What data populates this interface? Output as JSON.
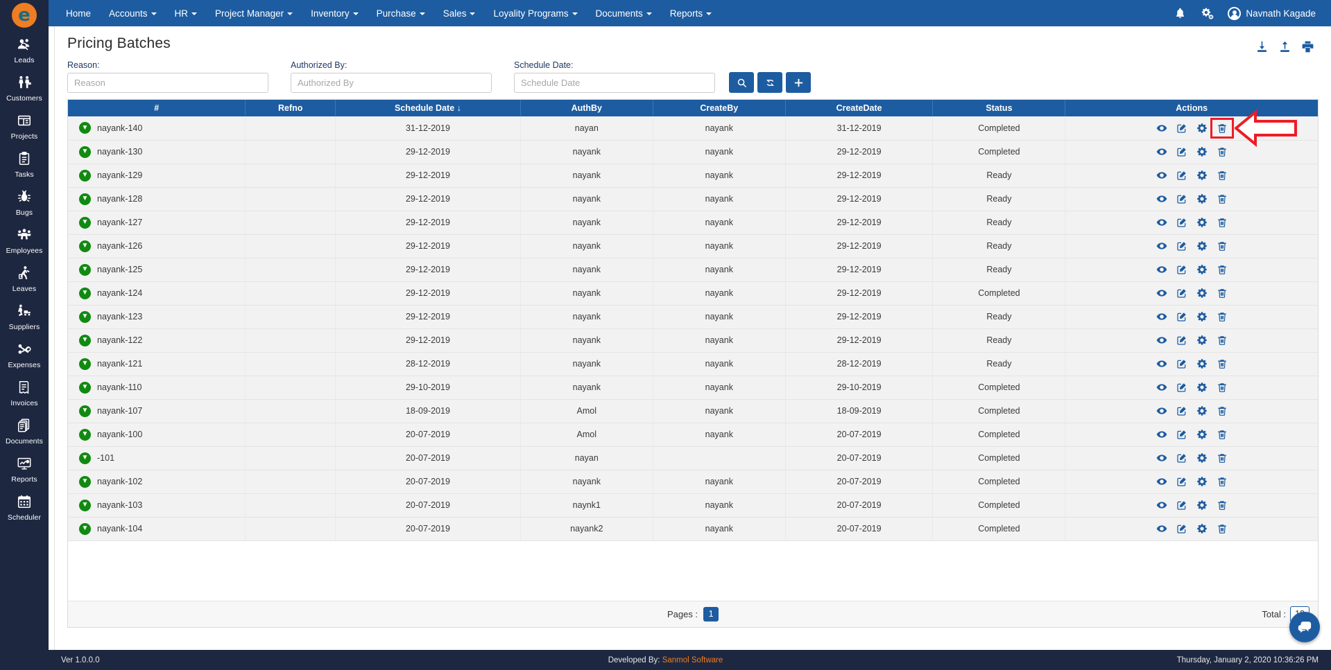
{
  "brand": {
    "logo_text": "e",
    "accent": "#ef7d22",
    "primary": "#1d5ca0",
    "sidebar_bg": "#1e2740"
  },
  "sidebar": {
    "items": [
      {
        "icon": "leads-icon",
        "label": "Leads"
      },
      {
        "icon": "customers-icon",
        "label": "Customers"
      },
      {
        "icon": "projects-icon",
        "label": "Projects"
      },
      {
        "icon": "tasks-icon",
        "label": "Tasks"
      },
      {
        "icon": "bugs-icon",
        "label": "Bugs"
      },
      {
        "icon": "employees-icon",
        "label": "Employees"
      },
      {
        "icon": "leaves-icon",
        "label": "Leaves"
      },
      {
        "icon": "suppliers-icon",
        "label": "Suppliers"
      },
      {
        "icon": "expenses-icon",
        "label": "Expenses"
      },
      {
        "icon": "invoices-icon",
        "label": "Invoices"
      },
      {
        "icon": "documents-icon",
        "label": "Documents"
      },
      {
        "icon": "reports-icon",
        "label": "Reports"
      },
      {
        "icon": "scheduler-icon",
        "label": "Scheduler"
      }
    ]
  },
  "topnav": {
    "items": [
      {
        "label": "Home",
        "dropdown": false
      },
      {
        "label": "Accounts",
        "dropdown": true
      },
      {
        "label": "HR",
        "dropdown": true
      },
      {
        "label": "Project Manager",
        "dropdown": true
      },
      {
        "label": "Inventory",
        "dropdown": true
      },
      {
        "label": "Purchase",
        "dropdown": true
      },
      {
        "label": "Sales",
        "dropdown": true
      },
      {
        "label": "Loyality Programs",
        "dropdown": true
      },
      {
        "label": "Documents",
        "dropdown": true
      },
      {
        "label": "Reports",
        "dropdown": true
      }
    ],
    "notification_icon": "bell-icon",
    "settings_icon": "gears-icon",
    "user_name": "Navnath Kagade"
  },
  "page": {
    "title": "Pricing Batches",
    "io_actions": [
      {
        "icon": "download-icon",
        "name": "download-button"
      },
      {
        "icon": "upload-icon",
        "name": "upload-button"
      },
      {
        "icon": "print-icon",
        "name": "print-button"
      }
    ]
  },
  "filters": {
    "reason": {
      "label": "Reason:",
      "placeholder": "Reason",
      "value": ""
    },
    "authorized_by": {
      "label": "Authorized By:",
      "placeholder": "Authorized By",
      "value": ""
    },
    "schedule_date": {
      "label": "Schedule Date:",
      "placeholder": "Schedule Date",
      "value": ""
    },
    "buttons": [
      {
        "icon": "search-icon",
        "name": "search-button"
      },
      {
        "icon": "refresh-icon",
        "name": "refresh-button"
      },
      {
        "icon": "plus-icon",
        "name": "add-button"
      }
    ]
  },
  "table": {
    "columns": [
      "#",
      "Refno",
      "Schedule Date ↓",
      "AuthBy",
      "CreateBy",
      "CreateDate",
      "Status",
      "Actions"
    ],
    "sort_column": "Schedule Date",
    "sort_direction": "desc",
    "row_actions": [
      "view-icon",
      "edit-icon",
      "gear-icon",
      "delete-icon"
    ],
    "rows": [
      {
        "id": "nayank-140",
        "refno": "",
        "schedule_date": "31-12-2019",
        "authby": "nayan",
        "createby": "nayank",
        "createdate": "31-12-2019",
        "status": "Completed"
      },
      {
        "id": "nayank-130",
        "refno": "",
        "schedule_date": "29-12-2019",
        "authby": "nayank",
        "createby": "nayank",
        "createdate": "29-12-2019",
        "status": "Completed"
      },
      {
        "id": "nayank-129",
        "refno": "",
        "schedule_date": "29-12-2019",
        "authby": "nayank",
        "createby": "nayank",
        "createdate": "29-12-2019",
        "status": "Ready"
      },
      {
        "id": "nayank-128",
        "refno": "",
        "schedule_date": "29-12-2019",
        "authby": "nayank",
        "createby": "nayank",
        "createdate": "29-12-2019",
        "status": "Ready"
      },
      {
        "id": "nayank-127",
        "refno": "",
        "schedule_date": "29-12-2019",
        "authby": "nayank",
        "createby": "nayank",
        "createdate": "29-12-2019",
        "status": "Ready"
      },
      {
        "id": "nayank-126",
        "refno": "",
        "schedule_date": "29-12-2019",
        "authby": "nayank",
        "createby": "nayank",
        "createdate": "29-12-2019",
        "status": "Ready"
      },
      {
        "id": "nayank-125",
        "refno": "",
        "schedule_date": "29-12-2019",
        "authby": "nayank",
        "createby": "nayank",
        "createdate": "29-12-2019",
        "status": "Ready"
      },
      {
        "id": "nayank-124",
        "refno": "",
        "schedule_date": "29-12-2019",
        "authby": "nayank",
        "createby": "nayank",
        "createdate": "29-12-2019",
        "status": "Completed"
      },
      {
        "id": "nayank-123",
        "refno": "",
        "schedule_date": "29-12-2019",
        "authby": "nayank",
        "createby": "nayank",
        "createdate": "29-12-2019",
        "status": "Ready"
      },
      {
        "id": "nayank-122",
        "refno": "",
        "schedule_date": "29-12-2019",
        "authby": "nayank",
        "createby": "nayank",
        "createdate": "29-12-2019",
        "status": "Ready"
      },
      {
        "id": "nayank-121",
        "refno": "",
        "schedule_date": "28-12-2019",
        "authby": "nayank",
        "createby": "nayank",
        "createdate": "28-12-2019",
        "status": "Ready"
      },
      {
        "id": "nayank-110",
        "refno": "",
        "schedule_date": "29-10-2019",
        "authby": "nayank",
        "createby": "nayank",
        "createdate": "29-10-2019",
        "status": "Completed"
      },
      {
        "id": "nayank-107",
        "refno": "",
        "schedule_date": "18-09-2019",
        "authby": "Amol",
        "createby": "nayank",
        "createdate": "18-09-2019",
        "status": "Completed"
      },
      {
        "id": "nayank-100",
        "refno": "",
        "schedule_date": "20-07-2019",
        "authby": "Amol",
        "createby": "nayank",
        "createdate": "20-07-2019",
        "status": "Completed"
      },
      {
        "id": "-101",
        "refno": "",
        "schedule_date": "20-07-2019",
        "authby": "nayan",
        "createby": "",
        "createdate": "20-07-2019",
        "status": "Completed"
      },
      {
        "id": "nayank-102",
        "refno": "",
        "schedule_date": "20-07-2019",
        "authby": "nayank",
        "createby": "nayank",
        "createdate": "20-07-2019",
        "status": "Completed"
      },
      {
        "id": "nayank-103",
        "refno": "",
        "schedule_date": "20-07-2019",
        "authby": "naynk1",
        "createby": "nayank",
        "createdate": "20-07-2019",
        "status": "Completed"
      },
      {
        "id": "nayank-104",
        "refno": "",
        "schedule_date": "20-07-2019",
        "authby": "nayank2",
        "createby": "nayank",
        "createdate": "20-07-2019",
        "status": "Completed"
      }
    ]
  },
  "pagination": {
    "pages_label": "Pages :",
    "current_page": "1",
    "total_label": "Total :",
    "total_count": "18"
  },
  "annotation": {
    "highlight_color": "#ee1c25",
    "target": "delete-icon-row-1",
    "arrow": "left-pointing-arrow"
  },
  "chat": {
    "icon": "chat-icon"
  },
  "footer": {
    "version": "Ver 1.0.0.0",
    "developed_by_label": "Developed By:",
    "developer": "Sanmol Software",
    "datetime": "Thursday, January 2, 2020 10:36:26 PM"
  }
}
